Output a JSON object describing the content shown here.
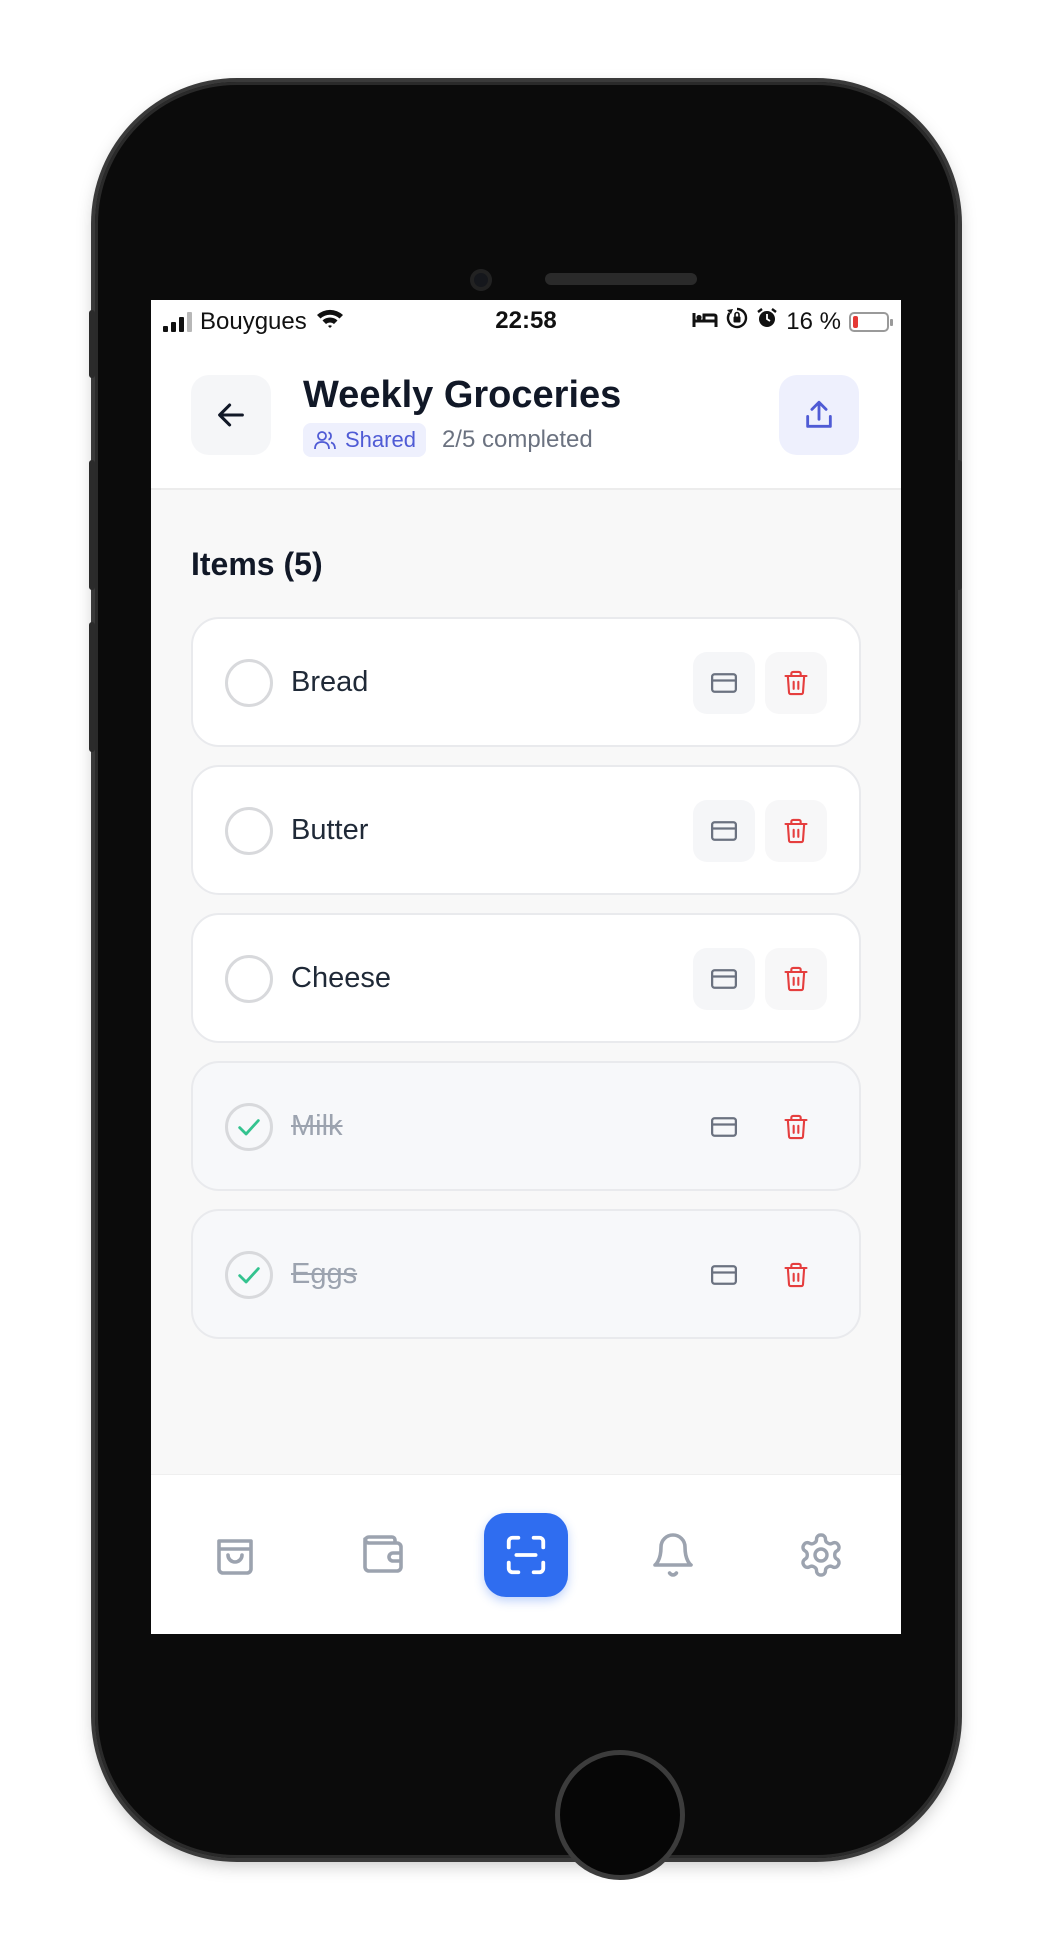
{
  "status_bar": {
    "carrier": "Bouygues",
    "time": "22:58",
    "battery_text": "16 %"
  },
  "header": {
    "title": "Weekly Groceries",
    "badge_label": "Shared",
    "progress_text": "2/5 completed"
  },
  "section": {
    "title": "Items (5)"
  },
  "items": [
    {
      "name": "Bread",
      "checked": false
    },
    {
      "name": "Butter",
      "checked": false
    },
    {
      "name": "Cheese",
      "checked": false
    },
    {
      "name": "Milk",
      "checked": true
    },
    {
      "name": "Eggs",
      "checked": true
    }
  ],
  "tab_bar": {
    "tabs": [
      "bag-icon",
      "wallet-icon",
      "scan-icon",
      "bell-icon",
      "gear-icon"
    ],
    "active": "scan-icon"
  },
  "colors": {
    "accent": "#2f6df0",
    "badge_text": "#4f5bd5",
    "check_green": "#34c38f",
    "delete_red": "#e53e3e"
  }
}
